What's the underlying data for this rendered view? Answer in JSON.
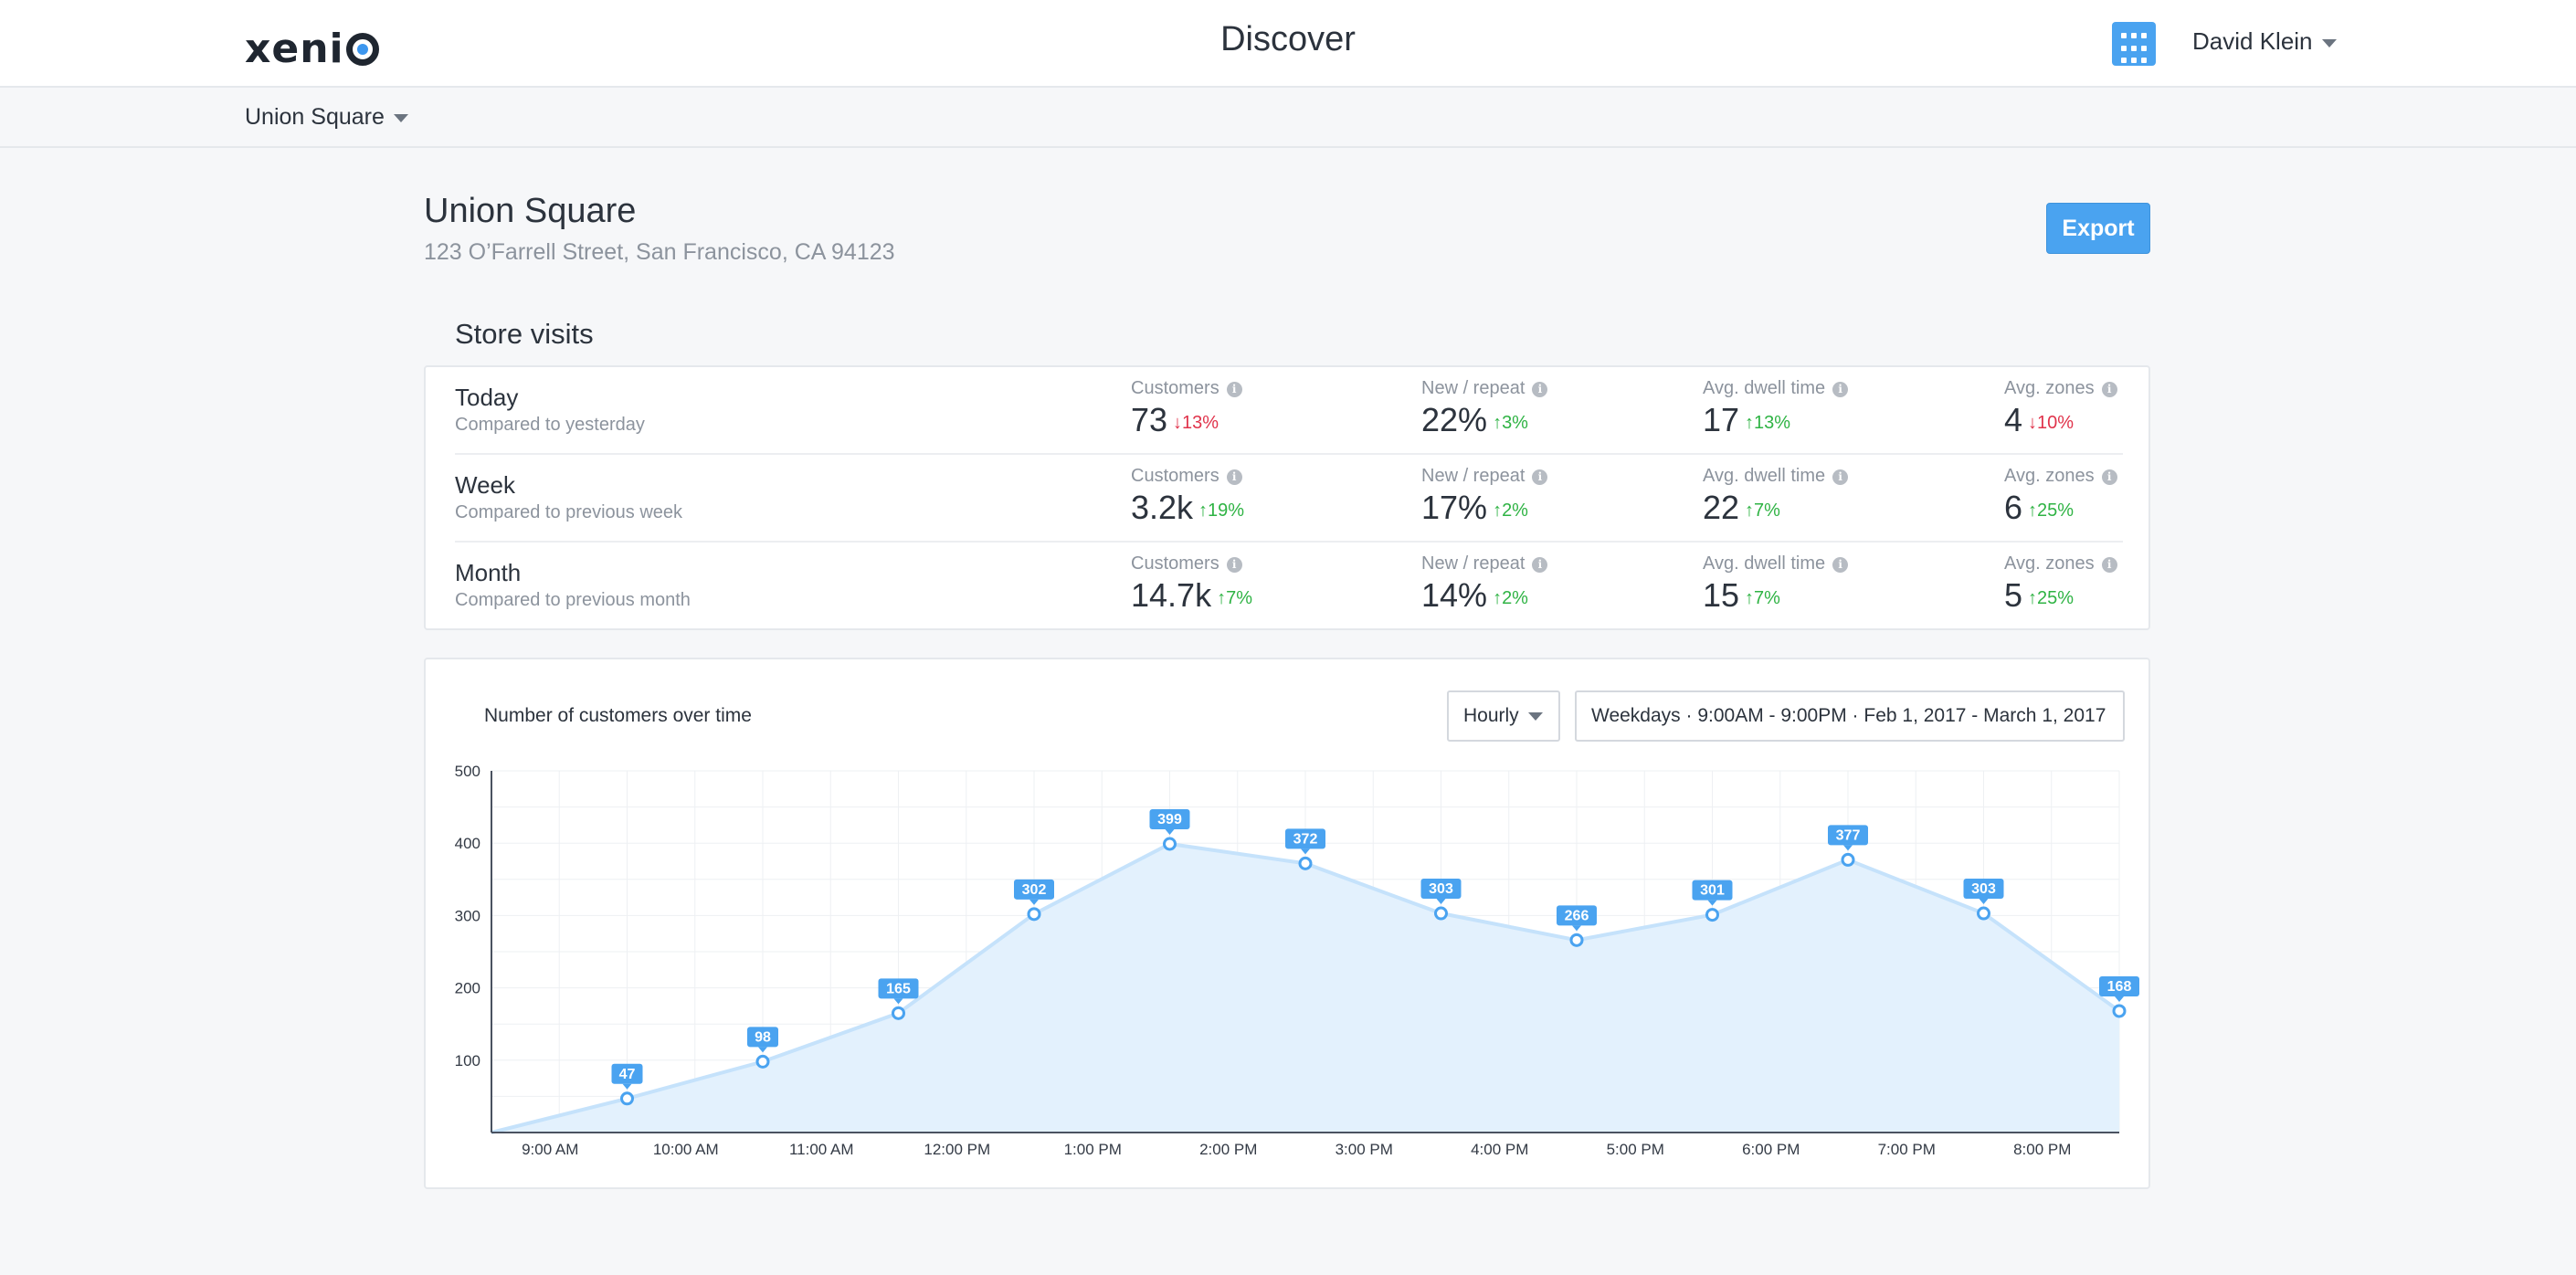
{
  "header": {
    "logo": "xenio",
    "title": "Discover",
    "user_name": "David Klein"
  },
  "location_selector": {
    "value": "Union Square"
  },
  "store": {
    "name": "Union Square",
    "address": "123 O’Farrell Street, San Francisco, CA 94123",
    "export_label": "Export"
  },
  "store_visits": {
    "title": "Store visits",
    "rows": [
      {
        "period": "Today",
        "comparison": "Compared to yesterday",
        "metrics": [
          {
            "label": "Customers",
            "value": "73",
            "change": "13%",
            "direction": "down"
          },
          {
            "label": "New / repeat",
            "value": "22%",
            "change": "3%",
            "direction": "up"
          },
          {
            "label": "Avg. dwell time",
            "value": "17",
            "change": "13%",
            "direction": "up"
          },
          {
            "label": "Avg. zones",
            "value": "4",
            "change": "10%",
            "direction": "down"
          }
        ]
      },
      {
        "period": "Week",
        "comparison": "Compared to previous week",
        "metrics": [
          {
            "label": "Customers",
            "value": "3.2k",
            "change": "19%",
            "direction": "up"
          },
          {
            "label": "New / repeat",
            "value": "17%",
            "change": "2%",
            "direction": "up"
          },
          {
            "label": "Avg. dwell time",
            "value": "22",
            "change": "7%",
            "direction": "up"
          },
          {
            "label": "Avg. zones",
            "value": "6",
            "change": "25%",
            "direction": "up"
          }
        ]
      },
      {
        "period": "Month",
        "comparison": "Compared to previous month",
        "metrics": [
          {
            "label": "Customers",
            "value": "14.7k",
            "change": "7%",
            "direction": "up"
          },
          {
            "label": "New / repeat",
            "value": "14%",
            "change": "2%",
            "direction": "up"
          },
          {
            "label": "Avg. dwell time",
            "value": "15",
            "change": "7%",
            "direction": "up"
          },
          {
            "label": "Avg. zones",
            "value": "5",
            "change": "25%",
            "direction": "up"
          }
        ]
      }
    ]
  },
  "chart_panel": {
    "title": "Number of customers over time",
    "granularity": "Hourly",
    "range": "Weekdays · 9:00AM - 9:00PM · Feb 1, 2017 - March 1, 2017"
  },
  "colors": {
    "accent": "#4aa3f0",
    "up": "#2fb344",
    "down": "#e0334b",
    "area_fill": "#e3f1fd",
    "line": "#c5e2fb"
  },
  "chart_data": {
    "type": "area",
    "title": "Number of customers over time",
    "categories": [
      "9:00 AM",
      "10:00 AM",
      "11:00 AM",
      "12:00 PM",
      "1:00 PM",
      "2:00 PM",
      "3:00 PM",
      "4:00 PM",
      "5:00 PM",
      "6:00 PM",
      "7:00 PM",
      "8:00 PM"
    ],
    "values": [
      47,
      98,
      165,
      302,
      399,
      372,
      303,
      266,
      301,
      377,
      303,
      168
    ],
    "y_ticks": [
      100,
      200,
      300,
      400,
      500
    ],
    "ylim": [
      0,
      500
    ],
    "grid": true,
    "data_labels": true
  }
}
